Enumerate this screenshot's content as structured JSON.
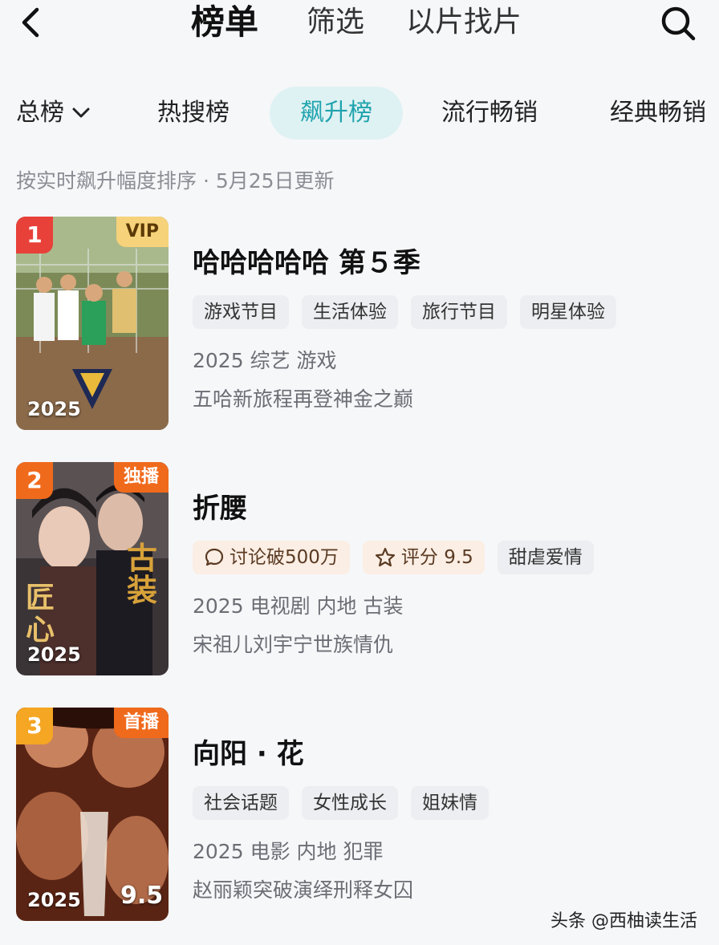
{
  "nav": {
    "tabs": [
      {
        "label": "榜单",
        "active": true
      },
      {
        "label": "筛选",
        "active": false
      },
      {
        "label": "以片找片",
        "active": false
      }
    ],
    "back_icon": "chevron-left-icon",
    "search_icon": "search-icon"
  },
  "categories": [
    {
      "label": "总榜",
      "dropdown": true
    },
    {
      "label": "热搜榜"
    },
    {
      "label": "飙升榜",
      "active": true
    },
    {
      "label": "流行畅销"
    },
    {
      "label": "经典畅销"
    }
  ],
  "subtitle": "按实时飙升幅度排序 · 5月25日更新",
  "items": [
    {
      "rank": "1",
      "badge": "VIP",
      "poster_year": "2025",
      "title": "哈哈哈哈哈 第５季",
      "tags": [
        "游戏节目",
        "生活体验",
        "旅行节目",
        "明星体验"
      ],
      "meta": "2025 综艺 游戏",
      "desc": "五哈新旅程再登神金之巅"
    },
    {
      "rank": "2",
      "badge": "独播",
      "poster_year": "2025",
      "title": "折腰",
      "hot_tags": [
        "讨论破500万",
        "评分 9.5"
      ],
      "tags": [
        "甜虐爱情"
      ],
      "meta": "2025 电视剧 内地 古装",
      "desc": "宋祖儿刘宇宁世族情仇",
      "poster_text": [
        "匠心",
        "古装"
      ]
    },
    {
      "rank": "3",
      "badge": "首播",
      "poster_year": "2025",
      "poster_score": "9.5",
      "title": "向阳 · 花",
      "tags": [
        "社会话题",
        "女性成长",
        "姐妹情"
      ],
      "meta": "2025 电影 内地 犯罪",
      "desc": "赵丽颖突破演绎刑释女囚"
    }
  ],
  "watermark": "头条 @西柚读生活",
  "colors": {
    "accent": "#1fa3ae",
    "rank1": "#e8413a",
    "rank2": "#f06a1c",
    "rank3": "#f5a623",
    "vip": "#f6d27a"
  }
}
